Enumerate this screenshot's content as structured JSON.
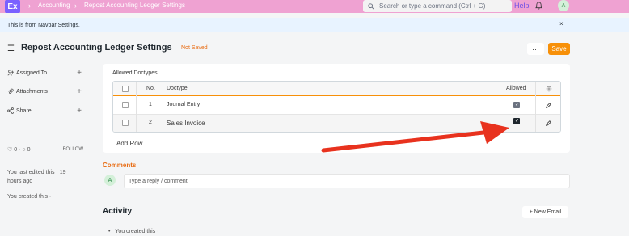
{
  "navbar": {
    "logo": "Ex",
    "breadcrumbs": [
      "Accounting",
      "Repost Accounting Ledger Settings"
    ],
    "search_placeholder": "Search or type a command (Ctrl + G)",
    "help": "Help",
    "avatar": "A"
  },
  "notice": {
    "text": "This is from Navbar Settings.",
    "close": "×"
  },
  "page": {
    "title": "Repost Accounting Ledger Settings",
    "status": "Not Saved",
    "more": "···",
    "save": "Save"
  },
  "sidebar": {
    "items": [
      {
        "label": "Assigned To"
      },
      {
        "label": "Attachments"
      },
      {
        "label": "Share"
      }
    ],
    "likes": "0",
    "comments_count": "0",
    "follow": "FOLLOW",
    "last_edited": "You last edited this · 19 hours ago",
    "created": "You created this ·"
  },
  "table": {
    "label": "Allowed Doctypes",
    "headers": {
      "no": "No.",
      "doctype": "Doctype",
      "allowed": "Allowed"
    },
    "rows": [
      {
        "no": "1",
        "doctype": "Journal Entry",
        "allowed": true
      },
      {
        "no": "2",
        "doctype": "Sales Invoice",
        "allowed": true
      }
    ],
    "add_row": "Add Row"
  },
  "comments": {
    "label": "Comments",
    "avatar": "A",
    "placeholder": "Type a reply / comment"
  },
  "activity": {
    "label": "Activity",
    "new_email": "+ New Email",
    "item": "You created this ·"
  },
  "colors": {
    "navbar": "#efa2d2",
    "accent": "#f79009",
    "annotation_arrow": "#e8321e"
  }
}
